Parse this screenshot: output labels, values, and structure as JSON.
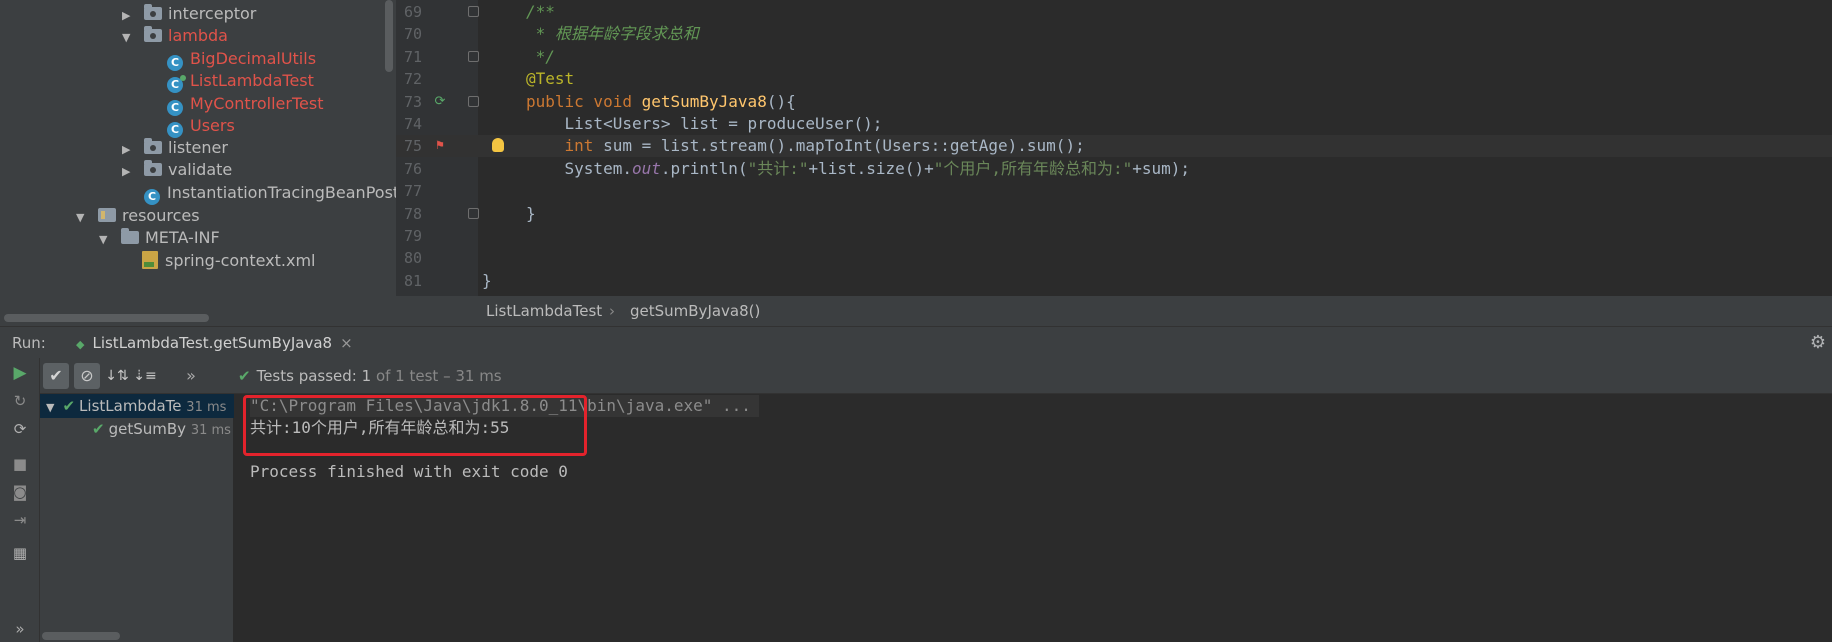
{
  "project_tree": {
    "items": [
      {
        "label": "interceptor",
        "type": "package",
        "expanded": false
      },
      {
        "label": "lambda",
        "type": "package",
        "expanded": true
      },
      {
        "label": "BigDecimalUtils",
        "type": "class"
      },
      {
        "label": "ListLambdaTest",
        "type": "test-class"
      },
      {
        "label": "MyControllerTest",
        "type": "class"
      },
      {
        "label": "Users",
        "type": "class"
      },
      {
        "label": "listener",
        "type": "package",
        "expanded": false
      },
      {
        "label": "validate",
        "type": "package",
        "expanded": false
      },
      {
        "label": "InstantiationTracingBeanPostPro",
        "type": "class"
      },
      {
        "label": "resources",
        "type": "resource-folder",
        "expanded": true
      },
      {
        "label": "META-INF",
        "type": "folder",
        "expanded": true
      },
      {
        "label": "spring-context.xml",
        "type": "xml"
      }
    ]
  },
  "editor": {
    "lines": [
      {
        "num": "69",
        "parts": [
          [
            "com",
            "/**"
          ]
        ]
      },
      {
        "num": "70",
        "parts": [
          [
            "com",
            " * 根据年龄字段求总和"
          ]
        ]
      },
      {
        "num": "71",
        "parts": [
          [
            "com",
            " */"
          ]
        ]
      },
      {
        "num": "72",
        "parts": [
          [
            "ann",
            "@Test"
          ]
        ]
      },
      {
        "num": "73",
        "parts": [
          [
            "kw",
            "public void "
          ],
          [
            "fn",
            "getSumByJava8"
          ],
          [
            "txt",
            "(){"
          ]
        ]
      },
      {
        "num": "74",
        "parts": [
          [
            "txt",
            "    List<Users> list = produceUser();"
          ]
        ]
      },
      {
        "num": "75",
        "parts": [
          [
            "kw",
            "    int "
          ],
          [
            "txt",
            "sum = list.stream().mapToInt(Users::getAge).sum();"
          ]
        ]
      },
      {
        "num": "76",
        "parts": [
          [
            "txt",
            "    System."
          ],
          [
            "stat",
            "out"
          ],
          [
            "txt",
            ".println("
          ],
          [
            "str",
            "\"共计:\""
          ],
          [
            "txt",
            "+list.size()+"
          ],
          [
            "str",
            "\"个用户,所有年龄总和为:\""
          ],
          [
            "txt",
            "+sum);"
          ]
        ]
      },
      {
        "num": "77",
        "parts": []
      },
      {
        "num": "78",
        "parts": [
          [
            "txt",
            "}"
          ]
        ]
      },
      {
        "num": "79",
        "parts": []
      },
      {
        "num": "80",
        "parts": []
      },
      {
        "num": "81",
        "parts": [
          [
            "txt",
            "}"
          ]
        ]
      }
    ]
  },
  "breadcrumb": {
    "class_name": "ListLambdaTest",
    "separator": "›",
    "method_name": "getSumByJava8()"
  },
  "run_panel": {
    "label": "Run:",
    "tab_label": "ListLambdaTest.getSumByJava8",
    "close_glyph": "×",
    "status": {
      "prefix": "Tests passed: ",
      "count": "1",
      "of_text": " of 1 test",
      "duration": " – 31 ms"
    },
    "more_glyph": "»"
  },
  "test_tree": {
    "rows": [
      {
        "label": "ListLambdaTe",
        "time": "31 ms"
      },
      {
        "label": "getSumBy",
        "time": "31 ms"
      }
    ]
  },
  "console": {
    "lines": [
      "\"C:\\Program Files\\Java\\jdk1.8.0_11\\bin\\java.exe\" ...",
      "共计:10个用户,所有年龄总和为:55",
      "",
      "Process finished with exit code 0"
    ]
  },
  "colors": {
    "accent_green": "#59a869",
    "highlight_red": "#e3232c",
    "keyword_orange": "#cc7832",
    "comment_green": "#629755"
  }
}
